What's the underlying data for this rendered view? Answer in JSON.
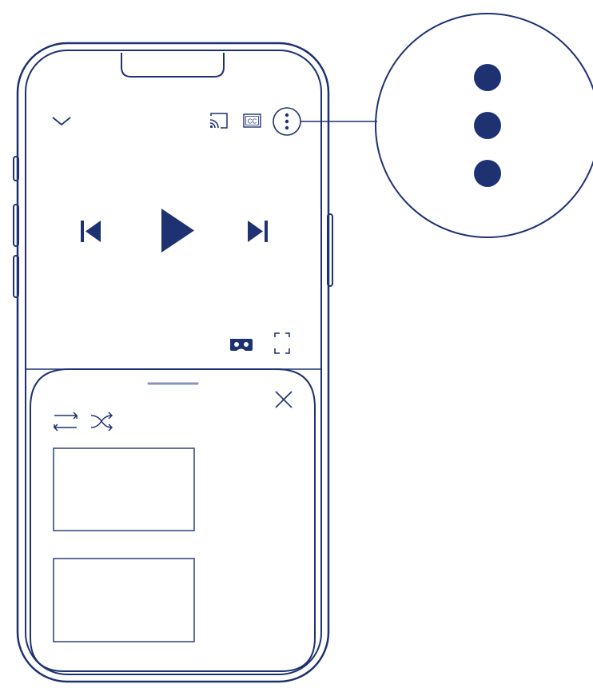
{
  "colors": {
    "ink": "#1e3272",
    "handle": "#8b93b8",
    "background": "#ffffff"
  },
  "header": {
    "collapse_icon": "chevron-down-icon",
    "cast_icon": "cast-icon",
    "captions_icon": "cc-icon",
    "captions_label": "CC",
    "more_icon": "more-vertical-icon"
  },
  "player": {
    "previous_icon": "skip-previous-icon",
    "play_icon": "play-icon",
    "next_icon": "skip-next-icon",
    "vr_icon": "cardboard-vr-icon",
    "fullscreen_icon": "fullscreen-icon"
  },
  "queue_sheet": {
    "drag_handle_icon": "drag-handle-icon",
    "close_icon": "close-icon",
    "repeat_icon": "repeat-icon",
    "shuffle_icon": "shuffle-icon",
    "thumbnails": [
      "video-thumbnail-1",
      "video-thumbnail-2"
    ]
  },
  "callout": {
    "icon": "more-vertical-icon",
    "dots": 3
  }
}
